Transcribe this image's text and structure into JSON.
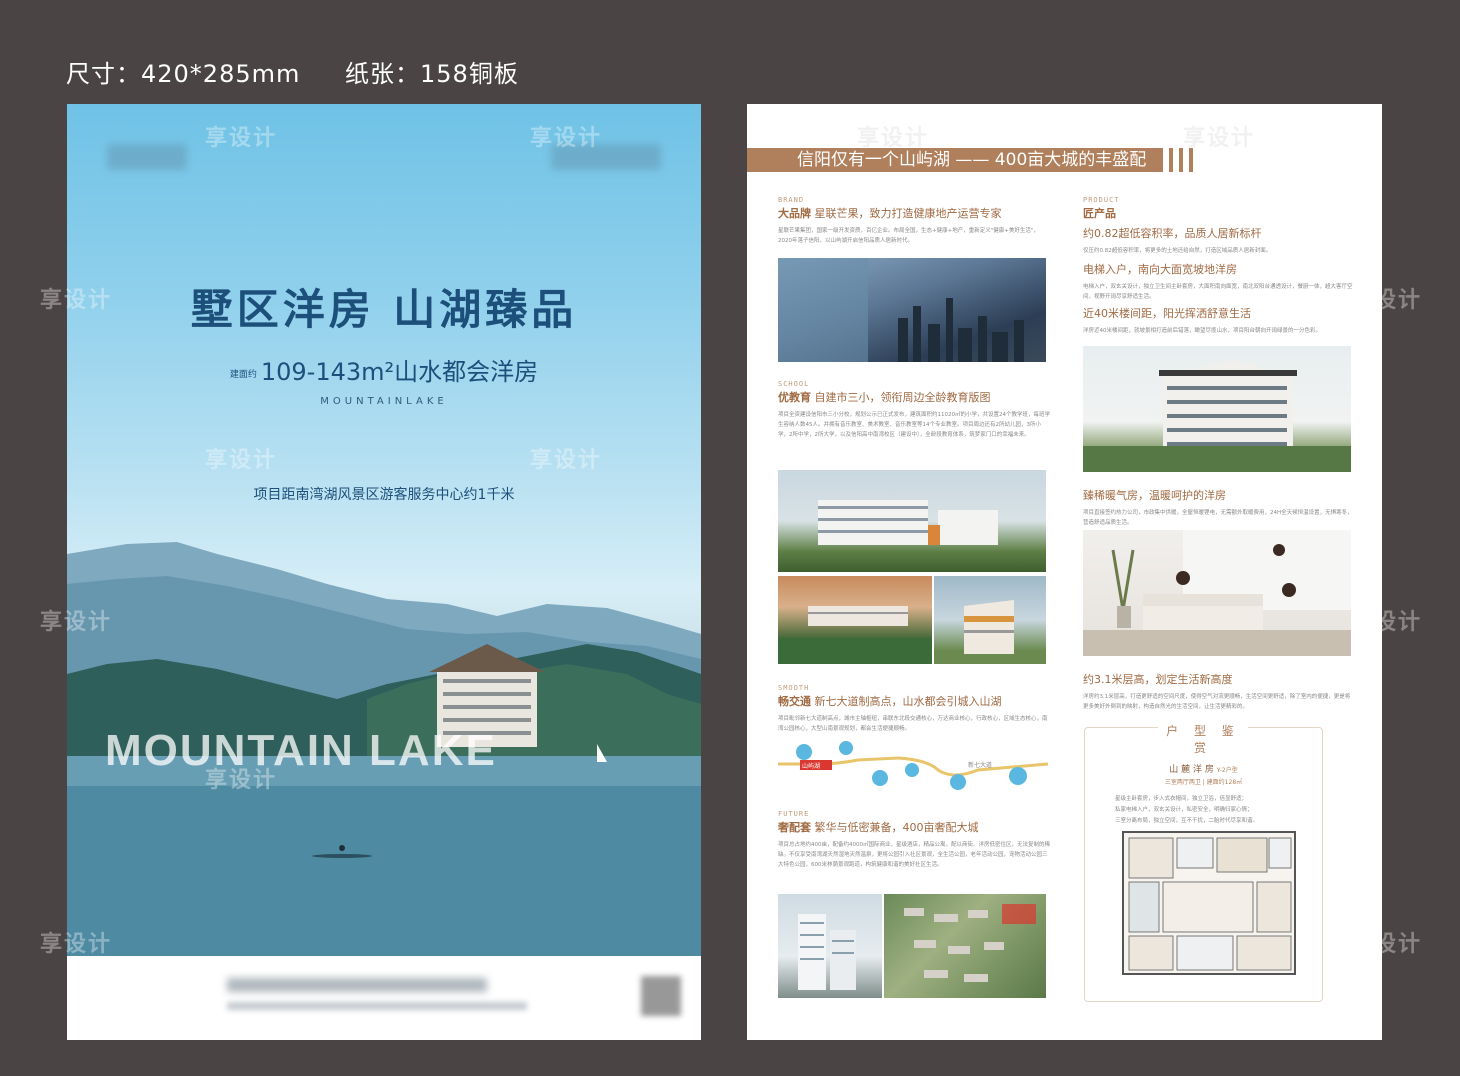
{
  "spec": {
    "size": "尺寸：420*285mm",
    "paper": "纸张：158铜板"
  },
  "front": {
    "headline": "墅区洋房  山湖臻品",
    "area_prefix": "建面约",
    "area": "109-143m²山水都会洋房",
    "english_name": "MOUNTAINLAKE",
    "distance": "项目距南湾湖风景区游客服务中心约1千米",
    "big_word": "MOUNTAIN LAKE"
  },
  "back": {
    "banner": "信阳仅有一个山屿湖 —— 400亩大城的丰盛配套",
    "brand": {
      "tag": "BRAND",
      "title_bold": "大品牌",
      "title": "星联芒果，致力打造健康地产运营专家",
      "text": "星联芒果集团，国家一级开发资质，百亿企业。布局全国，生态+健康+地产，重新定义\"健康+美好生活\"，2020年落子信阳，以山屿湖开启信阳品质人居新时代。"
    },
    "product": {
      "tag": "PRODUCT",
      "title_bold": "匠产品",
      "title": "约0.82超低容积率，品质人居新标杆",
      "text": "仅压约0.82超低容积率，将更多的土地还给自然，打造区域品质人居新封面。"
    },
    "elevator": {
      "title": "电梯入户，南向大面宽坡地洋房",
      "text": "电梯入户，双玄关设计，独立卫生间主卧套房，大面积南向面宽，南北双阳台通透设计，餐厨一体，超大客厅空间，视野开阔尽享舒适生活。"
    },
    "spacing": {
      "title": "近40米楼间距，阳光挥洒舒意生活",
      "text": "洋房近40米楼间距，就坡景相打造前后错落，瞰望尽揽山水，项目阳台朝向开阔绿景的一分色彩。"
    },
    "school": {
      "tag": "SCHOOL",
      "title_bold": "优教育",
      "title": "自建市三小，领衔周边全龄教育版图",
      "text": "项目全资建设信阳市三小分校，规划公示已正式发布，建筑面积约11020㎡的小学，共设置24个教学班，每班学生容纳人数45人。并拥有音乐教室、美术教室、音乐教室等14个专业教室。项目周边还有2所幼儿园，3所小学，2所中学，2所大学，以及信阳高中南湾校区（建设中），全龄段教育体系，筑梦家门口的幸福未来。"
    },
    "heating": {
      "title": "臻稀暖气房，温暖呵护的洋房",
      "text": "项目直接签约热力公司，市政集中供暖，全屋恒暖锂电，无需额外取暖费用，24H全天候恒温设置，无惧寒冬，营造舒适品质生活。"
    },
    "ceiling": {
      "title": "约3.1米层高，划定生活新高度",
      "text": "洋房约3.1米层高，打造更舒适的空间尺度，使得空气对流更顺畅，生活空间更舒适，除了室内的便捷，更是将更多美好外倒到的映射，构造自然光的生活空间，让生活更精彩的。"
    },
    "traffic": {
      "tag": "SMOOTH",
      "title_bold": "畅交通",
      "title": "新七大道制高点，山水都会引城入山湖",
      "text": "项目毗邻新七大道制高点，城市主轴枢纽，串联东北段交通核心，万达商业核心，行政核心，区域生态核心，南湾公园核心，大型山南景观规划，都会生活便捷顺畅。"
    },
    "map": {
      "label1": "山屿湖",
      "label2": "新七大道"
    },
    "future": {
      "tag": "FUTURE",
      "title_bold": "奢配套",
      "title": "繁华与低密兼备，400亩奢配大城",
      "text": "项目总占地约400亩，配备约4000㎡国际商业，星级酒店，精品公寓，配以商街、洋房低密住区，无法复制的稀缺。不仅享受南湾湖天然湿地天然温泉，更将公园引入社区景观，全生活公园，老年活动公园，宠物活动公园三大特色公园，600米林荫景观跑道，构筑健康和谐的美好社区生活。"
    },
    "plan": {
      "heading": "户 型 鉴 赏",
      "name": "山 麓 洋 房",
      "type": "Y-2户型",
      "desc": "三室两厅两卫 | 建面约128㎡",
      "features": [
        "星级主卧套房，步入式衣帽间，独立卫浴，倍显舒适；",
        "私家电梯入户，双玄关设计，私密安全，明确归家心情；",
        "三室分离布局，独立空间，互不干扰，二胎时代尽享和谐。"
      ]
    }
  },
  "watermark": "享设计"
}
